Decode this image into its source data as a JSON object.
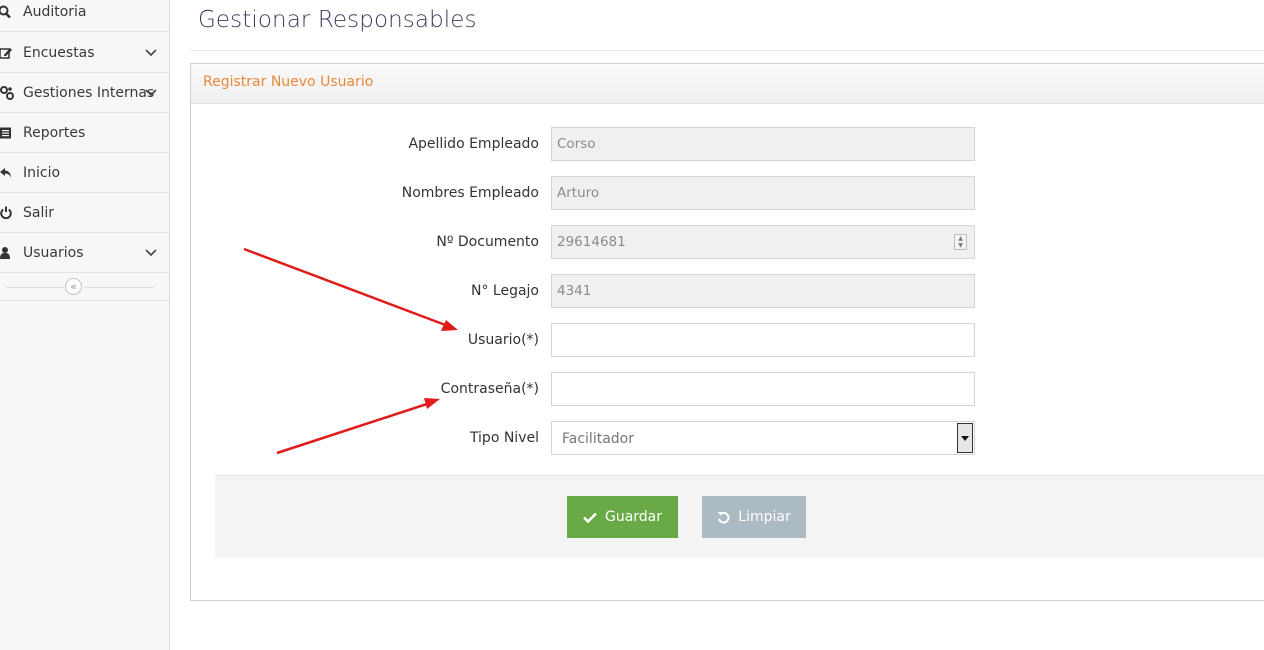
{
  "sidebar": {
    "items": [
      {
        "label": "Auditoria",
        "icon": "search-icon",
        "has_submenu": false
      },
      {
        "label": "Encuestas",
        "icon": "edit-icon",
        "has_submenu": true
      },
      {
        "label": "Gestiones Internas",
        "icon": "cogs-icon",
        "has_submenu": true
      },
      {
        "label": "Reportes",
        "icon": "list-icon",
        "has_submenu": false
      },
      {
        "label": "Inicio",
        "icon": "undo-arrow-icon",
        "has_submenu": false
      },
      {
        "label": "Salir",
        "icon": "power-icon",
        "has_submenu": false
      },
      {
        "label": "Usuarios",
        "icon": "user-icon",
        "has_submenu": true
      }
    ],
    "collapse_symbol": "«"
  },
  "page": {
    "title": "Gestionar Responsables"
  },
  "panel": {
    "title": "Registrar Nuevo Usuario",
    "fields": {
      "apellido": {
        "label": "Apellido Empleado",
        "value": "Corso"
      },
      "nombres": {
        "label": "Nombres Empleado",
        "value": "Arturo"
      },
      "documento": {
        "label": "Nº Documento",
        "value": "29614681"
      },
      "legajo": {
        "label": "N° Legajo",
        "value": "4341"
      },
      "usuario": {
        "label": "Usuario(*)",
        "value": ""
      },
      "contrasena": {
        "label": "Contraseña(*)",
        "value": ""
      },
      "tipo_nivel": {
        "label": "Tipo Nivel",
        "selected": "Facilitador"
      }
    },
    "buttons": {
      "save": "Guardar",
      "reset": "Limpiar"
    }
  },
  "colors": {
    "panel_title": "#e8883a",
    "save_button": "#69aa46",
    "reset_button": "#abbac3",
    "annotation_arrow": "#e01b1b"
  }
}
